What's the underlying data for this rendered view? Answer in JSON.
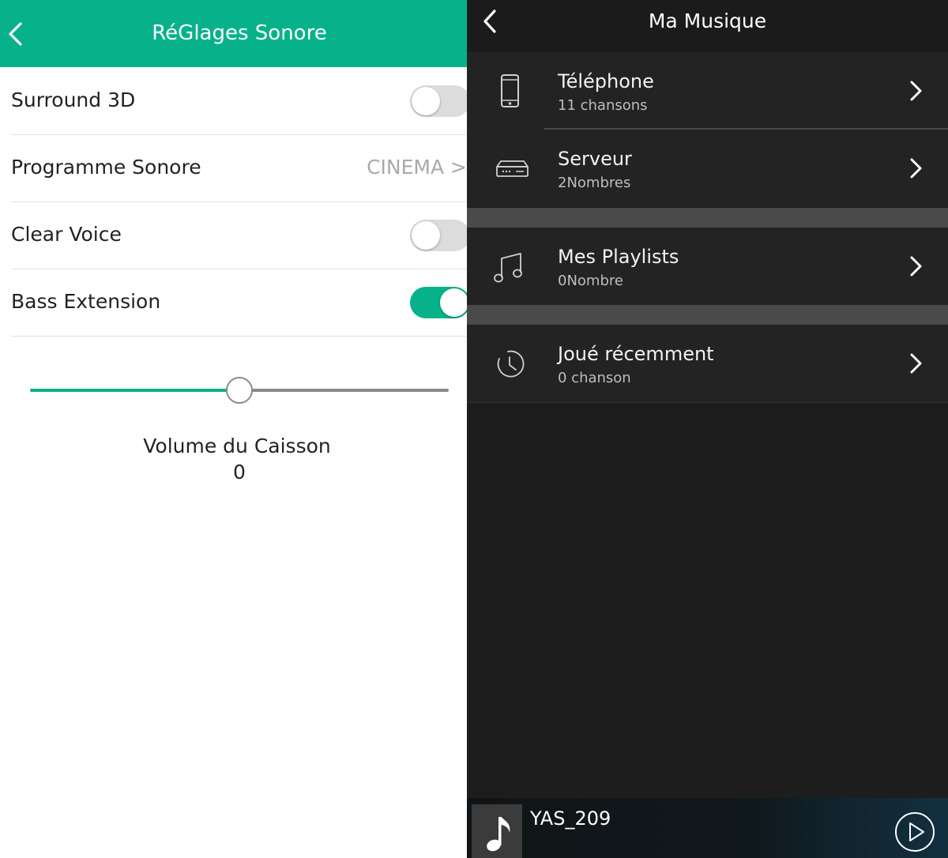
{
  "left": {
    "header": {
      "title": "RéGlages Sonore"
    },
    "settings": [
      {
        "label": "Surround 3D",
        "toggle": "off"
      },
      {
        "label": "Programme Sonore",
        "value": "CINEMA >"
      },
      {
        "label": "Clear Voice",
        "toggle": "off"
      },
      {
        "label": "Bass Extension",
        "toggle": "on"
      }
    ],
    "slider": {
      "label": "Volume du Caisson",
      "value": "0",
      "position_fraction": 0.5
    },
    "colors": {
      "accent": "#07b28b"
    }
  },
  "right": {
    "header": {
      "title": "Ma Musique"
    },
    "items": [
      {
        "title": "Téléphone",
        "subtitle": "11  chansons",
        "icon": "phone-icon"
      },
      {
        "title": "Serveur",
        "subtitle": "2Nombres",
        "icon": "server-icon"
      },
      {
        "title": "Mes Playlists",
        "subtitle": "0Nombre",
        "icon": "music-note-icon"
      },
      {
        "title": "Joué récemment",
        "subtitle": "0  chanson",
        "icon": "clock-icon"
      }
    ],
    "player": {
      "title": "YAS_209",
      "icon": "play-icon"
    }
  }
}
